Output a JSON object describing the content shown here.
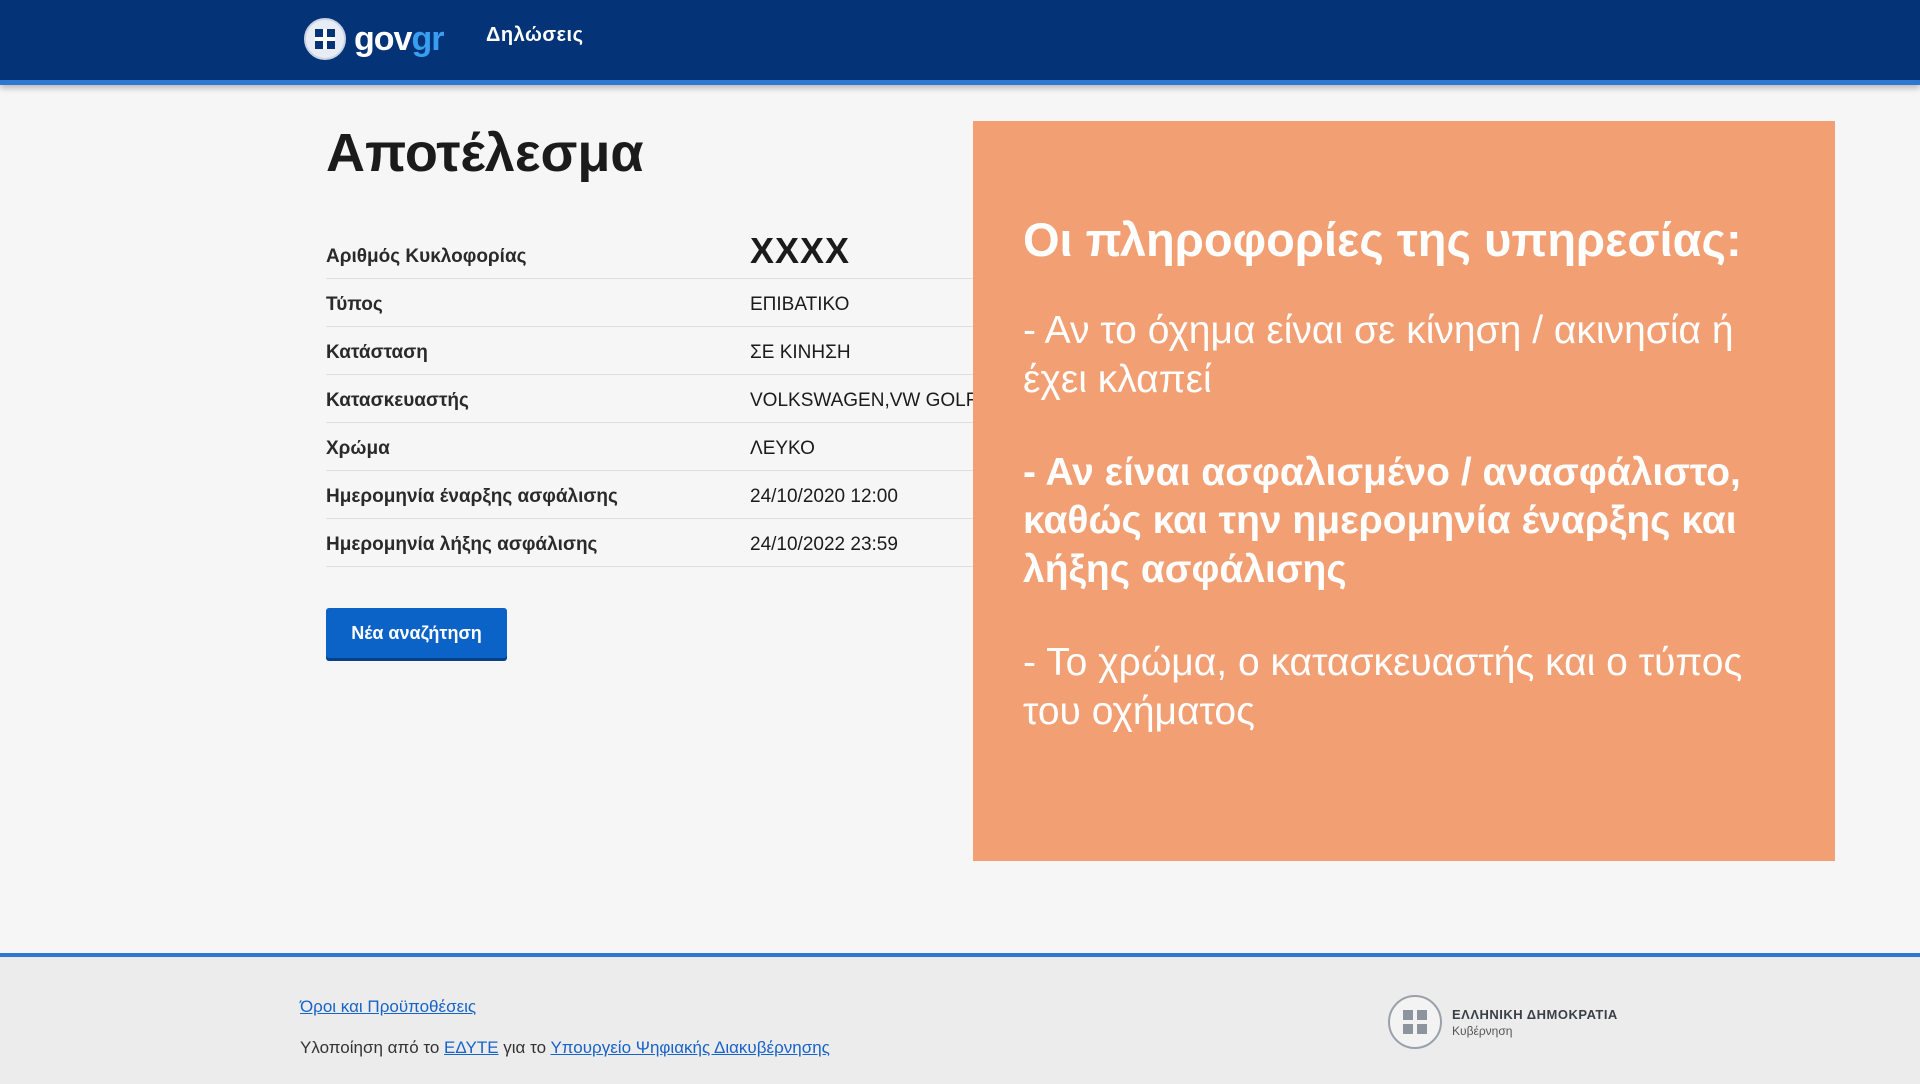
{
  "header": {
    "logo_gov": "gov",
    "logo_gr": "gr",
    "nav_link": "Δηλώσεις"
  },
  "main": {
    "title": "Αποτέλεσμα",
    "rows": [
      {
        "label": "Αριθμός Κυκλοφορίας",
        "value": "XXXX"
      },
      {
        "label": "Τύπος",
        "value": "ΕΠΙΒΑΤΙΚΟ"
      },
      {
        "label": "Κατάσταση",
        "value": "ΣΕ ΚΙΝΗΣΗ"
      },
      {
        "label": "Κατασκευαστής",
        "value": "VOLKSWAGEN,VW GOLF"
      },
      {
        "label": "Χρώμα",
        "value": "ΛΕΥΚΟ"
      },
      {
        "label": "Ημερομηνία έναρξης ασφάλισης",
        "value": "24/10/2020 12:00"
      },
      {
        "label": "Ημερομηνία λήξης ασφάλισης",
        "value": "24/10/2022 23:59"
      }
    ],
    "new_search_button": "Νέα αναζήτηση"
  },
  "overlay": {
    "title": "Οι πληροφορίες της υπηρεσίας:",
    "p1": "- Αν το όχημα είναι σε κίνηση / ακινησία ή έχει κλαπεί",
    "p2": "- Αν είναι ασφαλισμένο / ανασφάλιστο, καθώς και την ημερομηνία έναρξης και λήξης ασφάλισης",
    "p3": "- Το χρώμα, ο κατασκευαστής και ο τύπος του οχήματος"
  },
  "footer": {
    "terms_link": "Όροι και Προϋποθέσεις",
    "impl_prefix": "Υλοποίηση από το",
    "edyte_link": "ΕΔΥΤΕ",
    "impl_middle": "για το",
    "ministry_link": "Υπουργείο Ψηφιακής Διακυβέρνησης",
    "gov_name": "ΕΛΛΗΝΙΚΗ ΔΗΜΟΚΡΑΤΙΑ",
    "gov_sub": "Κυβέρνηση"
  },
  "colors": {
    "header_bg": "#043378",
    "accent_blue": "#2e78d2",
    "button_bg": "#0b63c7",
    "overlay_bg": "#f29f73",
    "link": "#1763c8"
  },
  "icons": [
    "govgr-emblem-icon",
    "hellenic-republic-emblem-icon"
  ]
}
